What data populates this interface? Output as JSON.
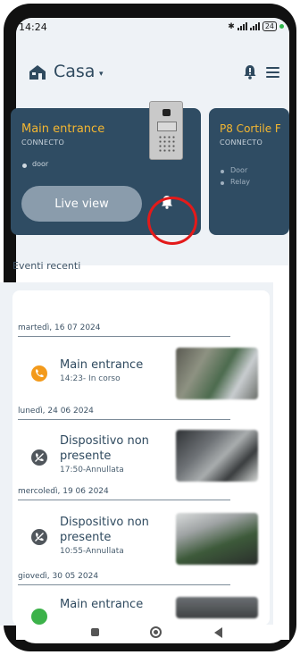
{
  "status_bar": {
    "time": "14:24",
    "battery": "24"
  },
  "header": {
    "title": "Casa",
    "caret": "▾"
  },
  "cards": [
    {
      "title": "Main entrance",
      "subtitle": "CONNECTO",
      "items": [
        "door"
      ],
      "button": "Live view"
    },
    {
      "title": "P8 Cortile F",
      "subtitle": "CONNECTO",
      "items": [
        "Door",
        "Relay"
      ]
    }
  ],
  "recent": {
    "title": "Eventi recenti",
    "events": [
      {
        "date": "martedì, 16 07 2024",
        "title": "Main entrance",
        "sub": "14:23- In corso",
        "icon": "phone-icon"
      },
      {
        "date": "lunedì, 24 06 2024",
        "title_lines": [
          "Dispositivo non",
          "presente"
        ],
        "sub": "17:50-Annullata",
        "icon": "missed-call-icon"
      },
      {
        "date": "mercoledì, 19 06 2024",
        "title_lines": [
          "Dispositivo non",
          "presente"
        ],
        "sub": "10:55-Annullata",
        "icon": "missed-call-icon"
      },
      {
        "date": "giovedì, 30 05 2024",
        "title": "Main entrance",
        "icon": "phone-icon"
      }
    ]
  },
  "colors": {
    "card_bg": "#2f4c63",
    "card_title": "#f5b731",
    "header_bg": "#eef2f6",
    "highlight": "#e31a1a"
  }
}
